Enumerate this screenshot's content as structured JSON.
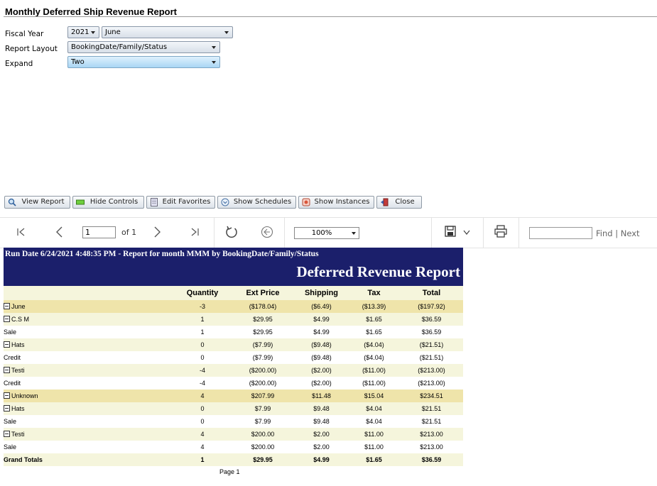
{
  "page_title": "Monthly Deferred Ship Revenue Report",
  "params": {
    "fiscal_year": {
      "label": "Fiscal Year",
      "year": "2021",
      "month": "June"
    },
    "report_layout": {
      "label": "Report Layout",
      "value": "BookingDate/Family/Status"
    },
    "expand": {
      "label": "Expand",
      "value": "Two"
    }
  },
  "toolbar": {
    "view_report": "View Report",
    "hide_controls": "Hide Controls",
    "edit_favorites": "Edit Favorites",
    "show_schedules": "Show Schedules",
    "show_instances": "Show Instances",
    "close": "Close"
  },
  "nav": {
    "page_value": "1",
    "of_label": "of 1",
    "zoom": "100%",
    "find_label": "Find",
    "divider": "|",
    "next_label": "Next",
    "icons": [
      "first-page-icon",
      "prev-page-icon",
      "next-page-icon",
      "last-page-icon",
      "refresh-icon",
      "back-icon",
      "save-icon",
      "print-icon"
    ]
  },
  "report": {
    "run_line": "Run Date 6/24/2021 4:48:35 PM - Report for month MMM by BookingDate/Family/Status",
    "title": "Deferred Revenue Report",
    "columns": [
      "Quantity",
      "Ext Price",
      "Shipping",
      "Tax",
      "Total"
    ],
    "rows": [
      {
        "name": "June",
        "qty": "-3",
        "ext": "($178.04)",
        "ship": "($6.49)",
        "tax": "($13.39)",
        "total": "($197.92)"
      },
      {
        "name": "C.S M",
        "qty": "1",
        "ext": "$29.95",
        "ship": "$4.99",
        "tax": "$1.65",
        "total": "$36.59"
      },
      {
        "name": "Sale",
        "qty": "1",
        "ext": "$29.95",
        "ship": "$4.99",
        "tax": "$1.65",
        "total": "$36.59"
      },
      {
        "name": "Hats",
        "qty": "0",
        "ext": "($7.99)",
        "ship": "($9.48)",
        "tax": "($4.04)",
        "total": "($21.51)"
      },
      {
        "name": "Credit",
        "qty": "0",
        "ext": "($7.99)",
        "ship": "($9.48)",
        "tax": "($4.04)",
        "total": "($21.51)"
      },
      {
        "name": "Testi",
        "qty": "-4",
        "ext": "($200.00)",
        "ship": "($2.00)",
        "tax": "($11.00)",
        "total": "($213.00)"
      },
      {
        "name": "Credit",
        "qty": "-4",
        "ext": "($200.00)",
        "ship": "($2.00)",
        "tax": "($11.00)",
        "total": "($213.00)"
      },
      {
        "name": "Unknown",
        "qty": "4",
        "ext": "$207.99",
        "ship": "$11.48",
        "tax": "$15.04",
        "total": "$234.51"
      },
      {
        "name": "Hats",
        "qty": "0",
        "ext": "$7.99",
        "ship": "$9.48",
        "tax": "$4.04",
        "total": "$21.51"
      },
      {
        "name": "Sale",
        "qty": "0",
        "ext": "$7.99",
        "ship": "$9.48",
        "tax": "$4.04",
        "total": "$21.51"
      },
      {
        "name": "Testi",
        "qty": "4",
        "ext": "$200.00",
        "ship": "$2.00",
        "tax": "$11.00",
        "total": "$213.00"
      },
      {
        "name": "Sale",
        "qty": "4",
        "ext": "$200.00",
        "ship": "$2.00",
        "tax": "$11.00",
        "total": "$213.00"
      }
    ],
    "grand_totals": {
      "name": "Grand Totals",
      "qty": "1",
      "ext": "$29.95",
      "ship": "$4.99",
      "tax": "$1.65",
      "total": "$36.59"
    },
    "page_footer": "Page 1"
  },
  "colors": {
    "report_header_bg": "#1b1f6b",
    "group_row_bg": "#efe4aa",
    "family_row_bg": "#f5f5dc",
    "dropdown_highlight": "#a9d6f4"
  }
}
